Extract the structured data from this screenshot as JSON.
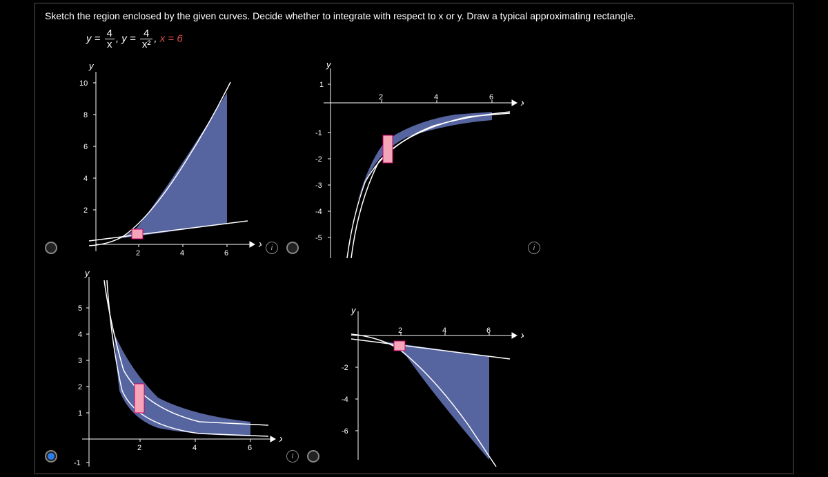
{
  "question": "Sketch the region enclosed by the given curves. Decide whether to integrate with respect to x or y. Draw a typical approximating rectangle.",
  "equation": {
    "eq1_lhs": "y =",
    "eq1_num": "4",
    "eq1_den": "x",
    "sep1": ",",
    "eq2_lhs": "y =",
    "eq2_num": "4",
    "eq2_den": "x²",
    "sep2": ",",
    "eq3": "x = 6"
  },
  "plots": {
    "p1": {
      "ylabel": "y",
      "xlabel": "x",
      "xticks": [
        "2",
        "4",
        "6"
      ],
      "yticks": [
        "2",
        "4",
        "6",
        "8",
        "10"
      ]
    },
    "p2": {
      "ylabel": "y",
      "xlabel": "x",
      "xticks": [
        "2",
        "4",
        "6"
      ],
      "yticks": [
        "-5",
        "-4",
        "-3",
        "-2",
        "-1",
        "1"
      ]
    },
    "p3": {
      "ylabel": "y",
      "xlabel": "x",
      "xticks": [
        "2",
        "4",
        "6"
      ],
      "yticks": [
        "-1",
        "1",
        "2",
        "3",
        "4",
        "5"
      ]
    },
    "p4": {
      "ylabel": "y",
      "xlabel": "x",
      "xticks": [
        "2",
        "4",
        "6"
      ],
      "yticks": [
        "-2",
        "-4",
        "-6"
      ]
    }
  },
  "chart_data": [
    {
      "id": "plot1",
      "type": "area",
      "xlim": [
        -0.5,
        7
      ],
      "ylim": [
        -0.5,
        10.5
      ],
      "description": "Region between increasing concave curve and straight line from x≈1 to x=6, shaded above line",
      "rect": {
        "x": 1.8,
        "y": 0.6,
        "w": 0.4,
        "h": 0.6
      }
    },
    {
      "id": "plot2",
      "type": "area",
      "xlim": [
        -0.5,
        7
      ],
      "ylim": [
        -5.2,
        1.2
      ],
      "description": "Region between two increasing curves approaching y=0 from below, shaded between them for x in [1,6]",
      "rect": {
        "x": 2.1,
        "y": -2.3,
        "w": 0.35,
        "h": 1.1
      }
    },
    {
      "id": "plot3",
      "type": "area",
      "xlim": [
        -0.5,
        7
      ],
      "ylim": [
        -1.2,
        5.2
      ],
      "description": "Region between y=4/x and y=4/x^2 for x in [1,6] in first quadrant",
      "rect": {
        "x": 1.9,
        "y": 1.1,
        "w": 0.35,
        "h": 1.0
      },
      "selected": true
    },
    {
      "id": "plot4",
      "type": "area",
      "xlim": [
        -0.5,
        7
      ],
      "ylim": [
        -10.5,
        0.5
      ],
      "description": "Mirror of plot1 below x-axis",
      "rect": {
        "x": 1.8,
        "y": -1.2,
        "w": 0.4,
        "h": 0.6
      }
    }
  ]
}
